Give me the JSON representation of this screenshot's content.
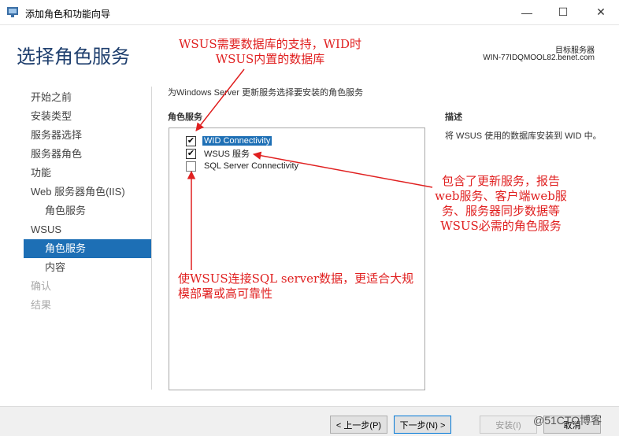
{
  "window": {
    "title": "添加角色和功能向导",
    "minimize_glyph": "—",
    "maximize_glyph": "☐",
    "close_glyph": "✕"
  },
  "header": {
    "page_title": "选择角色服务",
    "destination_label": "目标服务器",
    "destination_value": "WIN-77IDQMOOL82.benet.com"
  },
  "nav": {
    "items": [
      {
        "label": "开始之前",
        "state": "normal",
        "level": 0
      },
      {
        "label": "安装类型",
        "state": "normal",
        "level": 0
      },
      {
        "label": "服务器选择",
        "state": "normal",
        "level": 0
      },
      {
        "label": "服务器角色",
        "state": "normal",
        "level": 0
      },
      {
        "label": "功能",
        "state": "normal",
        "level": 0
      },
      {
        "label": "Web 服务器角色(IIS)",
        "state": "normal",
        "level": 0
      },
      {
        "label": "角色服务",
        "state": "normal",
        "level": 1
      },
      {
        "label": "WSUS",
        "state": "normal",
        "level": 0
      },
      {
        "label": "角色服务",
        "state": "active",
        "level": 1
      },
      {
        "label": "内容",
        "state": "normal",
        "level": 1
      },
      {
        "label": "确认",
        "state": "disabled",
        "level": 0
      },
      {
        "label": "结果",
        "state": "disabled",
        "level": 0
      }
    ]
  },
  "content": {
    "intro": "为Windows Server 更新服务选择要安装的角色服务",
    "role_services_title": "角色服务",
    "role_services": [
      {
        "label": "WID Connectivity",
        "checked": true,
        "selected": true
      },
      {
        "label": "WSUS 服务",
        "checked": true,
        "selected": false
      },
      {
        "label": "SQL Server Connectivity",
        "checked": false,
        "selected": false
      }
    ],
    "description_title": "描述",
    "description_text": "将 WSUS 使用的数据库安装到 WID 中。"
  },
  "footer": {
    "prev_label": "< 上一步(P)",
    "next_label": "下一步(N) >",
    "install_label": "安装(I)",
    "cancel_label": "取消",
    "watermark": "@51CTO博客"
  },
  "annotations": {
    "top": "WSUS需要数据库的支持，WID时WSUS内置的数据库",
    "right": "包含了更新服务，报告web服务、客户端web服务、服务器同步数据等WSUS必需的角色服务",
    "bottom": "使WSUS连接SQL server数据，更适合大规模部署或高可靠性",
    "color": "#e02020"
  },
  "colors": {
    "accent": "#1d6fb5",
    "title_blue": "#1f3f6e"
  }
}
